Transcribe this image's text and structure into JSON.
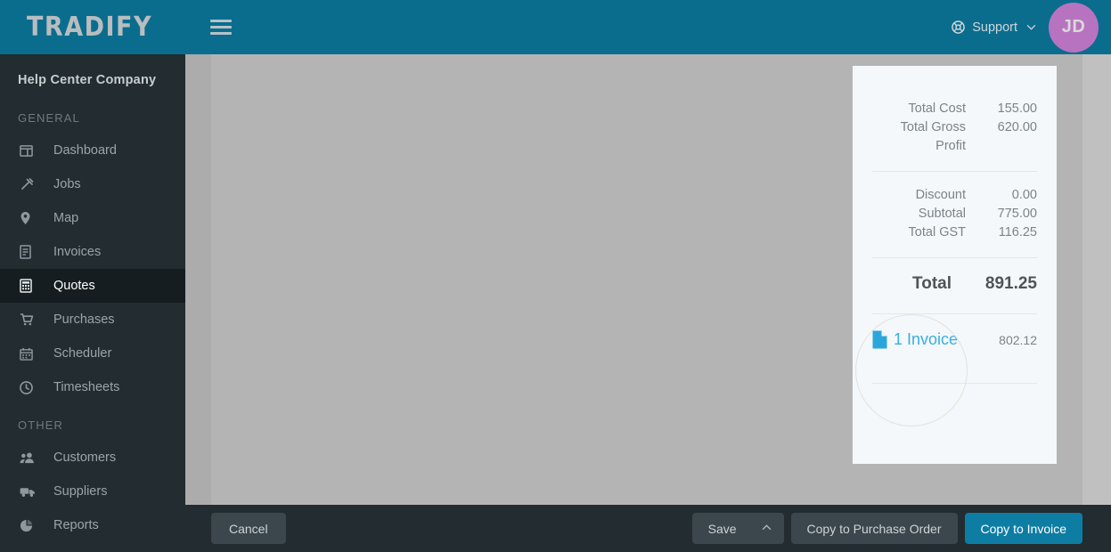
{
  "header": {
    "logo": "TRADIFY",
    "menu_icon": "hamburger-icon",
    "support_label": "Support",
    "support_caret": "⌄",
    "avatar_initials": "JD",
    "bg_color": "#0a6d8e",
    "avatar_color": "#b873c0"
  },
  "sidebar": {
    "company": "Help Center Company",
    "sections": [
      {
        "title": "GENERAL",
        "items": [
          {
            "label": "Dashboard",
            "icon": "dashboard-icon",
            "active": false
          },
          {
            "label": "Jobs",
            "icon": "hammer-icon",
            "active": false
          },
          {
            "label": "Map",
            "icon": "map-pin-icon",
            "active": false
          },
          {
            "label": "Invoices",
            "icon": "invoice-document-icon",
            "active": false
          },
          {
            "label": "Quotes",
            "icon": "calculator-icon",
            "active": true
          },
          {
            "label": "Purchases",
            "icon": "shopping-cart-icon",
            "active": false
          },
          {
            "label": "Scheduler",
            "icon": "calendar-icon",
            "active": false
          },
          {
            "label": "Timesheets",
            "icon": "clock-icon",
            "active": false
          }
        ]
      },
      {
        "title": "OTHER",
        "items": [
          {
            "label": "Customers",
            "icon": "people-icon",
            "active": false
          },
          {
            "label": "Suppliers",
            "icon": "truck-icon",
            "active": false
          },
          {
            "label": "Reports",
            "icon": "pie-chart-icon",
            "active": false
          }
        ]
      }
    ]
  },
  "totals_card": {
    "rows": [
      {
        "label": "Total Cost",
        "value": "155.00"
      },
      {
        "label": "Total Gross Profit",
        "value": "620.00"
      }
    ],
    "rows2": [
      {
        "label": "Discount",
        "value": "0.00"
      },
      {
        "label": "Subtotal",
        "value": "775.00"
      },
      {
        "label": "Total GST",
        "value": "116.25"
      }
    ],
    "total_label": "Total",
    "total_value": "891.25",
    "invoice_link": "1 Invoice",
    "invoice_icon": "document-icon",
    "invoice_amount": "802.12",
    "link_color": "#3aaede"
  },
  "actionbar": {
    "cancel": "Cancel",
    "save": "Save",
    "save_caret": "▲",
    "copy_to_purchase_order": "Copy to Purchase Order",
    "copy_to_invoice": "Copy to Invoice",
    "primary_color": "#0e7da3"
  }
}
